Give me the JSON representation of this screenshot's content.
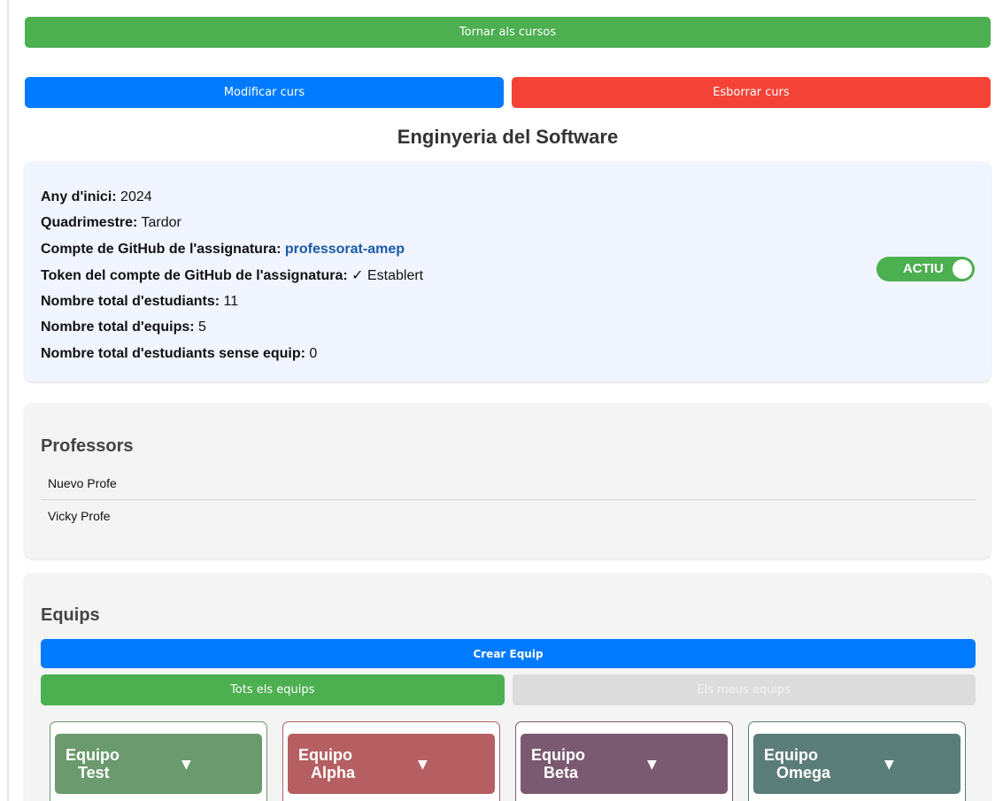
{
  "nav": {
    "back_label": "Tornar als cursos"
  },
  "actions": {
    "modify_label": "Modificar curs",
    "delete_label": "Esborrar curs"
  },
  "course": {
    "title": "Enginyeria del Software",
    "start_year_label": "Any d'inici:",
    "start_year": "2024",
    "semester_label": "Quadrimestre:",
    "semester": "Tardor",
    "github_account_label": "Compte de GitHub de l'assignatura:",
    "github_account": "professorat-amep",
    "github_token_label": "Token del compte de GitHub de l'assignatura:",
    "github_token_check": "✓",
    "github_token_status": "Establert",
    "total_students_label": "Nombre total d'estudiants:",
    "total_students": "11",
    "total_teams_label": "Nombre total d'equips:",
    "total_teams": "5",
    "students_no_team_label": "Nombre total d'estudiants sense equip:",
    "students_no_team": "0",
    "status_toggle_label": "ACTIU"
  },
  "professors": {
    "title": "Professors",
    "items": [
      "Nuevo Profe",
      "Vicky Profe"
    ]
  },
  "teams": {
    "title": "Equips",
    "create_label": "Crear Equip",
    "filter_all_label": "Tots els equips",
    "filter_mine_label": "Els meus equips",
    "arrow": "▼",
    "items": [
      {
        "line1": "Equipo",
        "line2": "Test",
        "color": "#6a9a6e"
      },
      {
        "line1": "Equipo",
        "line2": "Alpha",
        "color": "#b55f62"
      },
      {
        "line1": "Equipo",
        "line2": "Beta",
        "color": "#7a5a70"
      },
      {
        "line1": "Equipo",
        "line2": "Omega",
        "color": "#5a7d7a"
      }
    ]
  },
  "colors": {
    "green": "#4caf50",
    "blue": "#007bff",
    "red": "#f44336",
    "info_bg": "#f0f5ff",
    "link": "#1a5aa8"
  }
}
